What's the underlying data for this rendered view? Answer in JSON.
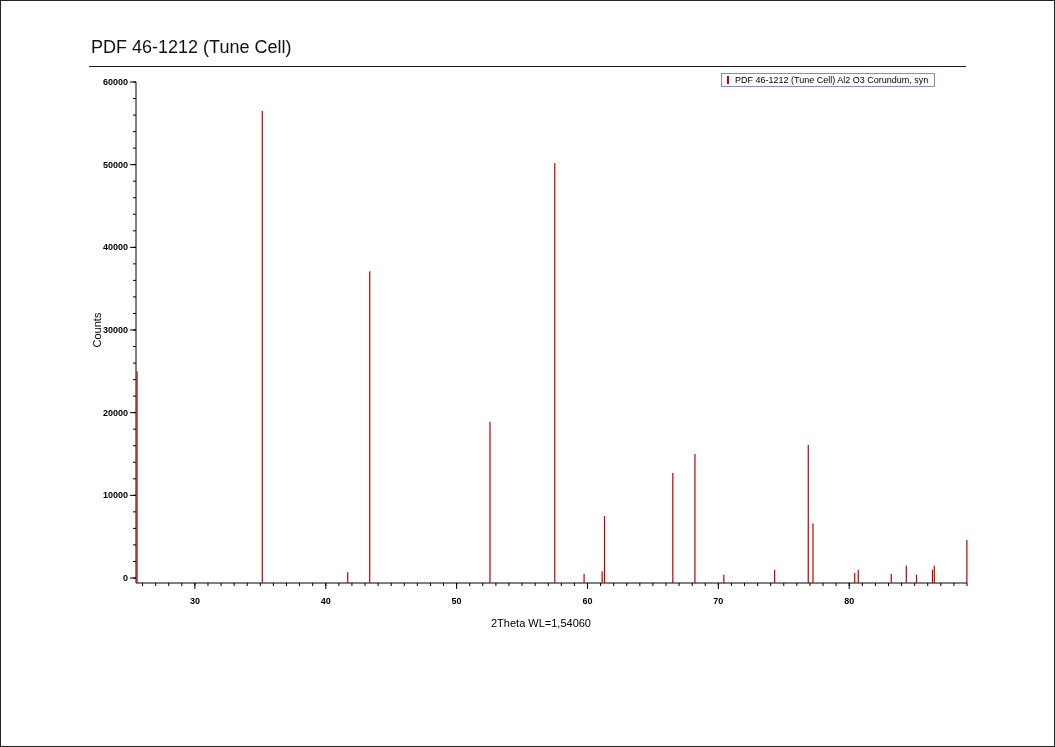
{
  "title": "PDF 46-1212 (Tune Cell)",
  "chart": {
    "chart_data": {
      "type": "bar",
      "xlabel": "2Theta WL=1,54060",
      "ylabel": "Counts",
      "x": [
        25.58,
        35.15,
        41.68,
        43.36,
        52.55,
        57.5,
        59.74,
        61.12,
        61.3,
        66.52,
        68.21,
        70.42,
        74.3,
        76.87,
        77.23,
        80.42,
        80.69,
        83.21,
        84.36,
        85.14,
        86.36,
        86.5,
        88.99
      ],
      "series": [
        {
          "name": "PDF 46-1212 (Tune Cell) Al2 O3 Corundum, syn",
          "color": "#c00000",
          "values": [
            25000,
            56500,
            700,
            37100,
            18900,
            50200,
            500,
            800,
            7500,
            12700,
            15000,
            400,
            1000,
            16100,
            6600,
            600,
            1000,
            500,
            1500,
            400,
            1000,
            1500,
            4600
          ]
        }
      ],
      "xlim": [
        25.5,
        89.0
      ],
      "ylim": [
        0,
        60000
      ],
      "xticks": [
        30,
        40,
        50,
        60,
        70,
        80
      ],
      "yticks": [
        0,
        10000,
        20000,
        30000,
        40000,
        50000,
        60000
      ]
    }
  }
}
